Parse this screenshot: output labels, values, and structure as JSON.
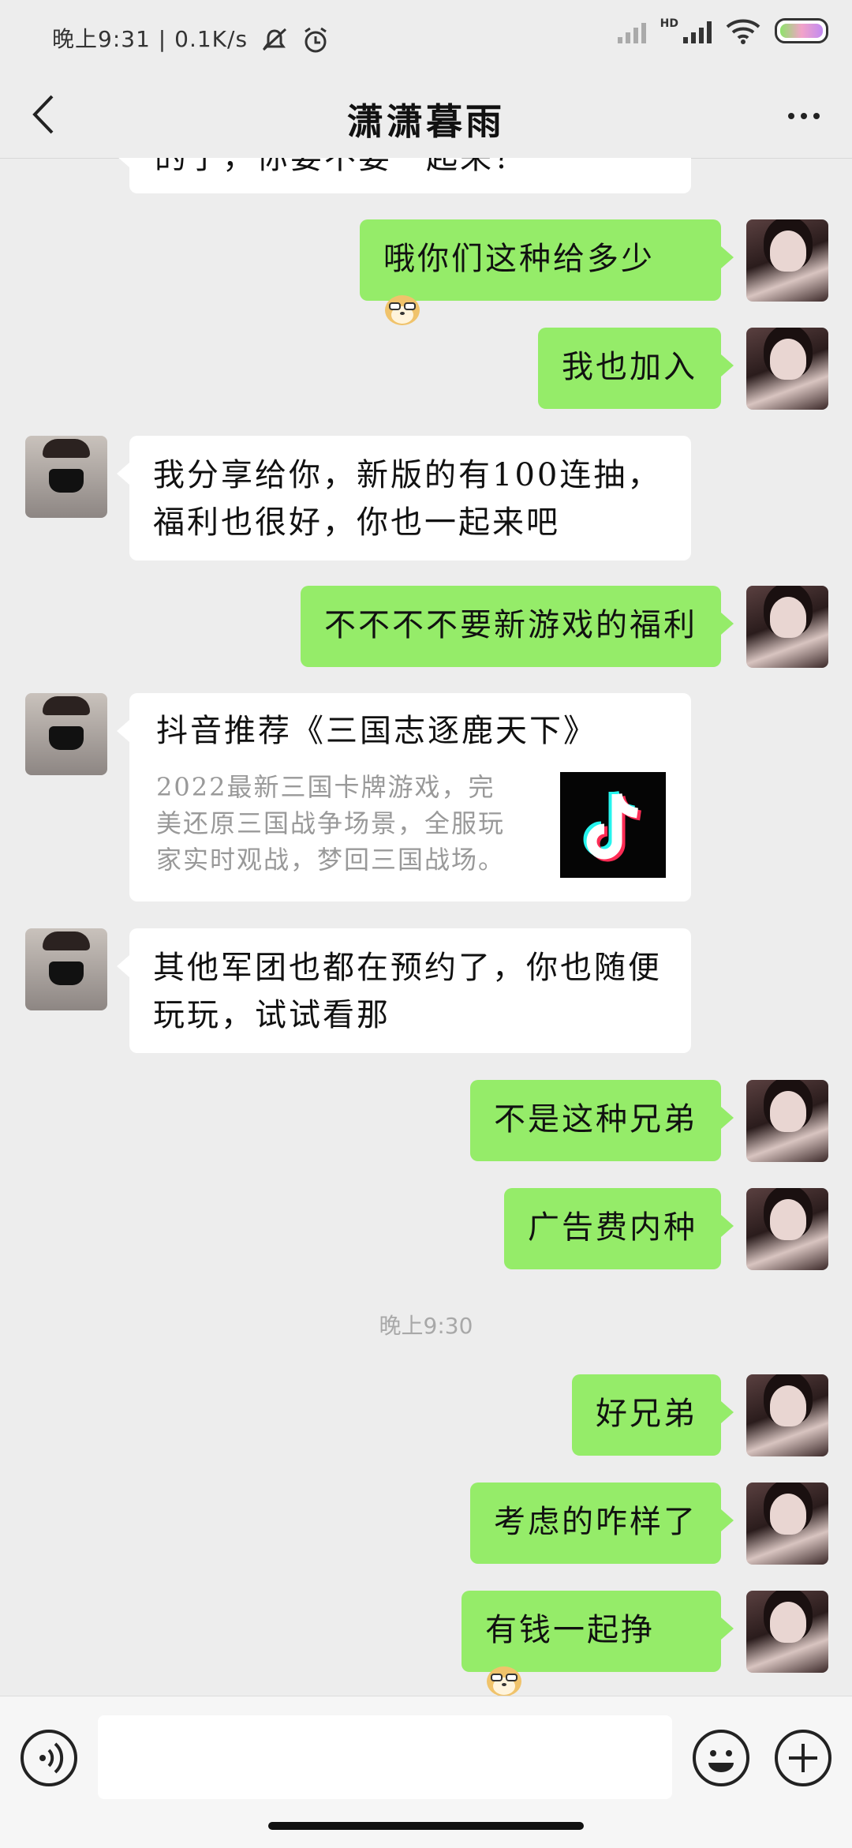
{
  "status_bar": {
    "time": "晚上9:31",
    "speed": "0.1K/s",
    "network_label": "HD",
    "icons": [
      "mute-icon",
      "alarm-icon",
      "signal-icon",
      "wifi-icon",
      "battery-icon"
    ]
  },
  "header": {
    "title": "潇潇暮雨",
    "back_icon": "chevron-left-icon",
    "more_icon": "more-icon"
  },
  "messages": [
    {
      "side": "in",
      "text": "的了，你要不要一起来？"
    },
    {
      "side": "out",
      "text": "哦你们这种给多少",
      "emoji": "doge"
    },
    {
      "side": "out",
      "text": "我也加入"
    },
    {
      "side": "in",
      "text": "我分享给你，新版的有100连抽，福利也很好，你也一起来吧"
    },
    {
      "side": "out",
      "text": "不不不不要新游戏的福利"
    },
    {
      "side": "in",
      "type": "share_card",
      "title": "抖音推荐《三国志逐鹿天下》",
      "desc": "2022最新三国卡牌游戏，完美还原三国战争场景，全服玩家实时观战，梦回三国战场。"
    },
    {
      "side": "in",
      "text": "其他军团也都在预约了，你也随便玩玩，试试看那"
    },
    {
      "side": "out",
      "text": "不是这种兄弟"
    },
    {
      "side": "out",
      "text": "广告费内种"
    },
    {
      "type": "time",
      "text": "晚上9:30"
    },
    {
      "side": "out",
      "text": "好兄弟"
    },
    {
      "side": "out",
      "text": "考虑的咋样了"
    },
    {
      "side": "out",
      "text": "有钱一起挣",
      "emoji": "doge"
    }
  ],
  "colors": {
    "background": "#ededed",
    "outgoing_bubble": "#95ec69",
    "incoming_bubble": "#ffffff"
  },
  "input_bar": {
    "icons": [
      "voice-icon",
      "emoji-icon",
      "plus-icon"
    ]
  }
}
